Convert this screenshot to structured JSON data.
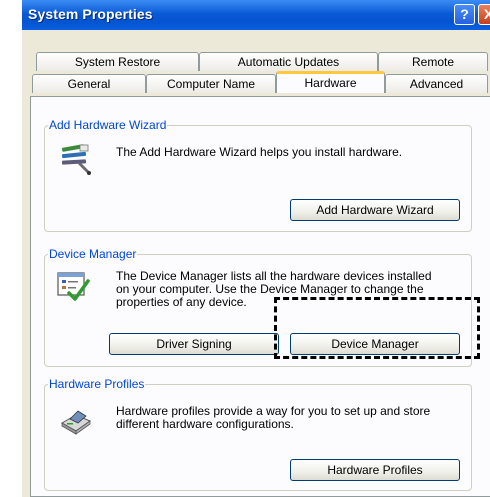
{
  "window": {
    "title": "System Properties",
    "help_symbol": "?",
    "close_symbol": "X"
  },
  "tabs_row1": [
    {
      "label": "System Restore"
    },
    {
      "label": "Automatic Updates"
    },
    {
      "label": "Remote"
    }
  ],
  "tabs_row2": [
    {
      "label": "General"
    },
    {
      "label": "Computer Name"
    },
    {
      "label": "Hardware",
      "active": true
    },
    {
      "label": "Advanced"
    }
  ],
  "add_hardware_wizard": {
    "group_label": "Add Hardware Wizard",
    "description": "The Add Hardware Wizard helps you install hardware.",
    "button_label": "Add Hardware Wizard",
    "icon": "add-hardware-wizard-icon"
  },
  "device_manager": {
    "group_label": "Device Manager",
    "description_lines": [
      "The Device Manager lists all the hardware devices installed",
      "on your computer. Use the Device Manager to change the",
      "properties of any device."
    ],
    "driver_signing_label": "Driver Signing",
    "device_manager_label": "Device Manager",
    "icon": "device-manager-icon"
  },
  "hardware_profiles": {
    "group_label": "Hardware Profiles",
    "description_lines": [
      "Hardware profiles provide a way for you to set up and store",
      "different hardware configurations."
    ],
    "button_label": "Hardware Profiles",
    "icon": "hardware-profiles-icon"
  },
  "colors": {
    "title_bar": "#0a5ad8",
    "group_label": "#0046d5",
    "active_tab_accent": "#ffc83c",
    "dialog_bg": "#ece9d8"
  }
}
